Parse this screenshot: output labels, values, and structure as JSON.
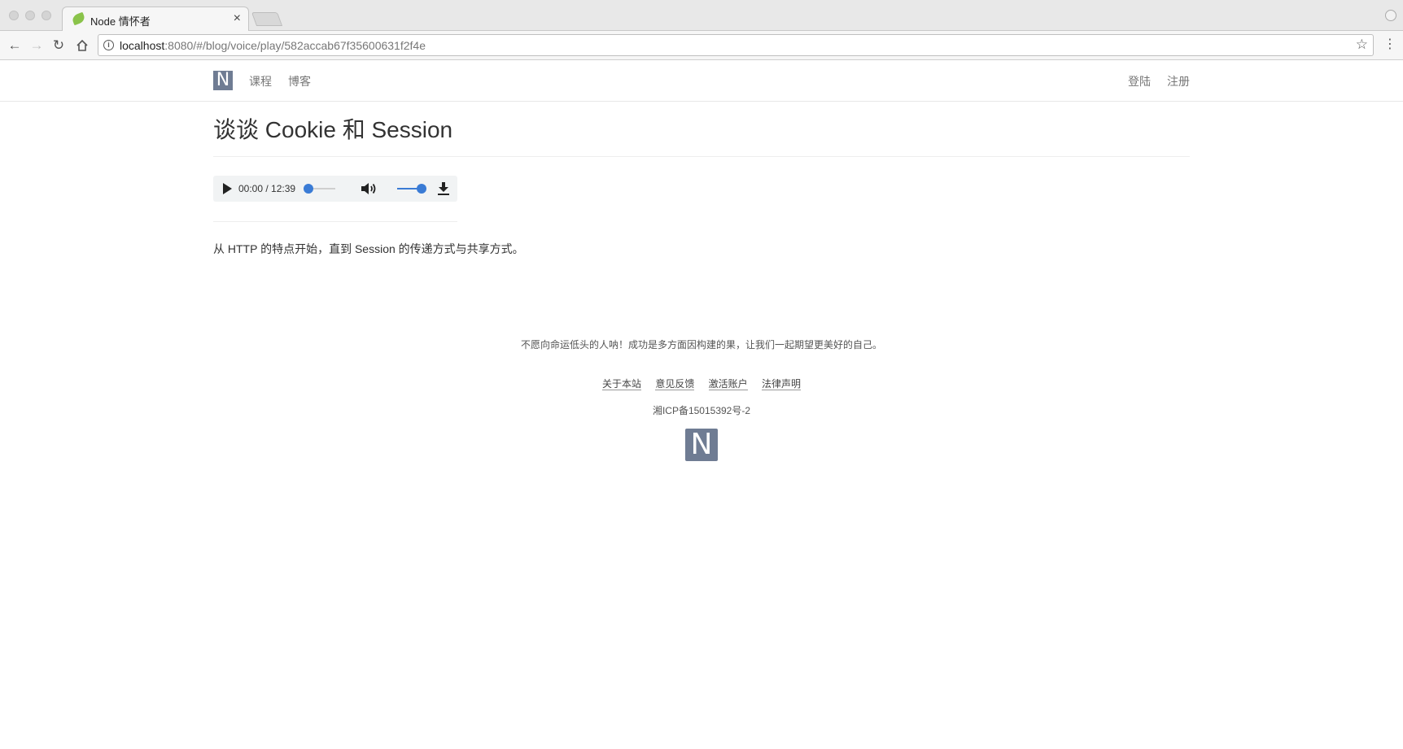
{
  "browser": {
    "tab_title": "Node 情怀者",
    "tab_close": "×",
    "url_host": "localhost",
    "url_path": ":8080/#/blog/voice/play/582accab67f35600631f2f4e"
  },
  "site": {
    "logo_letter": "N",
    "nav_left": [
      "课程",
      "博客"
    ],
    "nav_right": [
      "登陆",
      "注册"
    ]
  },
  "post": {
    "title": "谈谈 Cookie 和 Session",
    "summary": "从 HTTP 的特点开始，直到 Session 的传递方式与共享方式。"
  },
  "audio": {
    "time_display": "00:00 / 12:39",
    "seek_fraction": 0,
    "volume_fraction": 1
  },
  "footer": {
    "motto": "不愿向命运低头的人呐！成功是多方面因构建的果，让我们一起期望更美好的自己。",
    "links": [
      "关于本站",
      "意见反馈",
      "激活账户",
      "法律声明"
    ],
    "icp": "湘ICP备15015392号-2",
    "logo_letter": "N"
  },
  "colors": {
    "accent": "#3a7bd5",
    "logo_bg": "#6f7c93",
    "favicon": "#8ac34a"
  }
}
